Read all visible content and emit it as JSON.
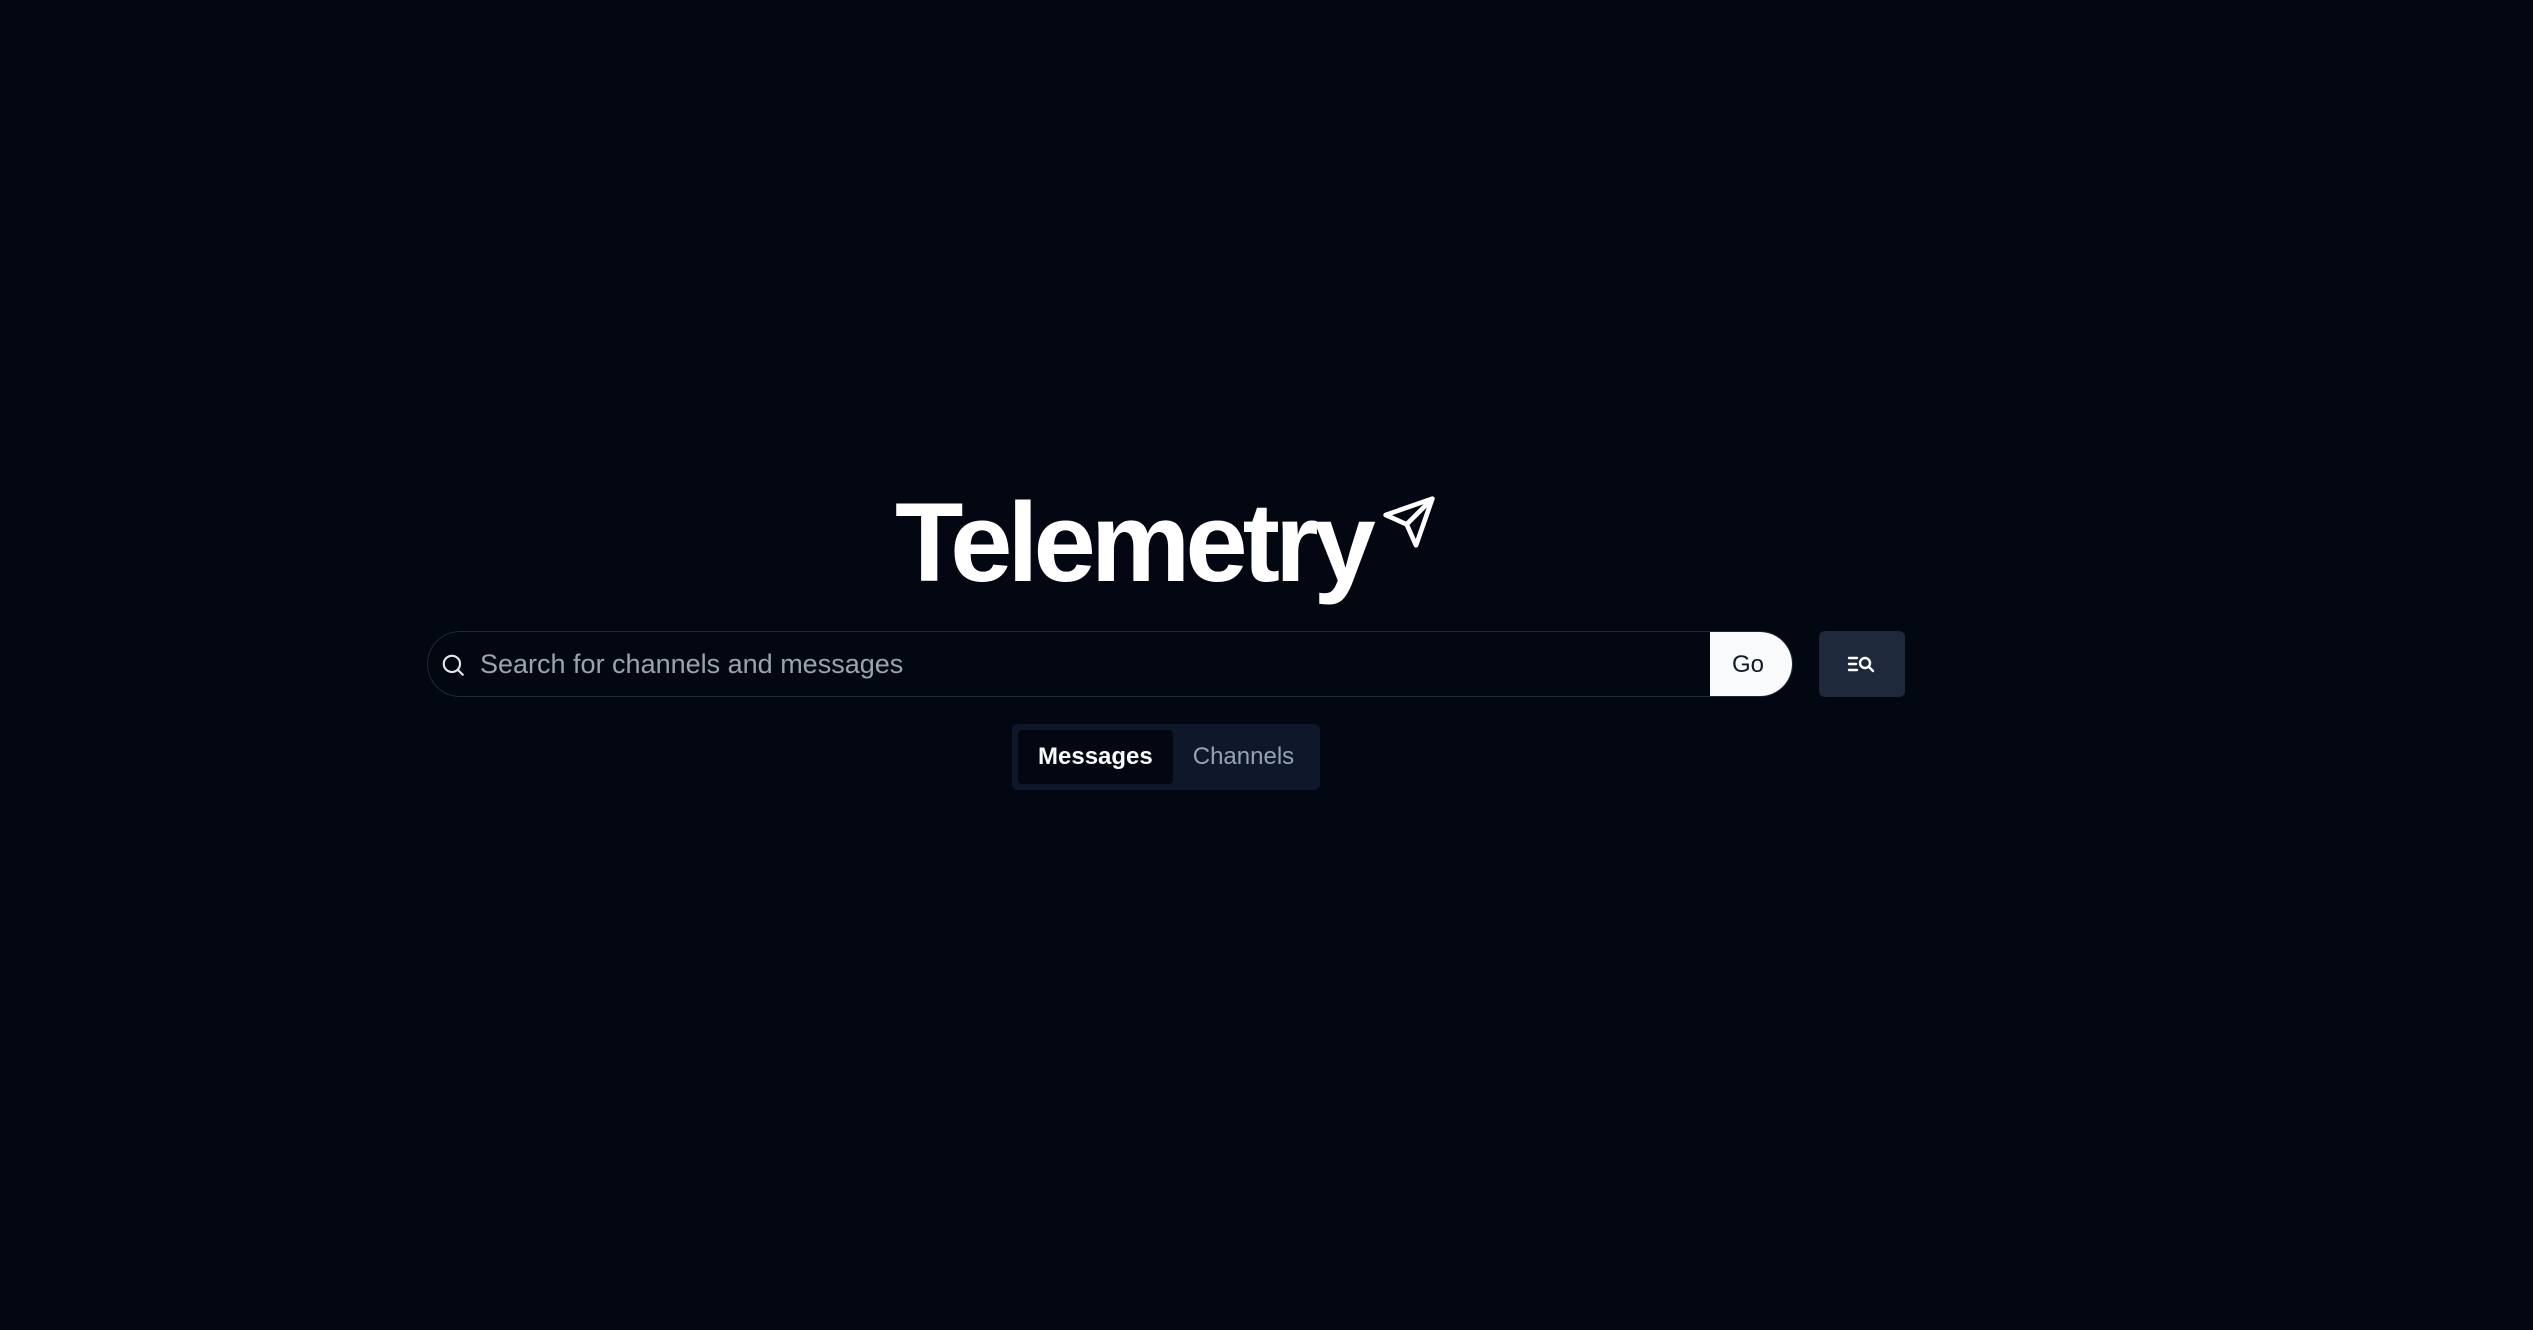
{
  "app": {
    "logo_text": "Telemetry",
    "logo_icon": "paper-plane-icon"
  },
  "search": {
    "placeholder": "Search for channels and messages",
    "value": "",
    "search_icon": "search-icon",
    "go_label": "Go",
    "advanced_icon": "advanced-search-icon"
  },
  "tabs": [
    {
      "label": "Messages",
      "active": true
    },
    {
      "label": "Channels",
      "active": false
    }
  ],
  "colors": {
    "background": "#030712",
    "go_button": "#f9fafb",
    "advanced_button": "#1e293b",
    "tabs_background": "#0f172a"
  }
}
